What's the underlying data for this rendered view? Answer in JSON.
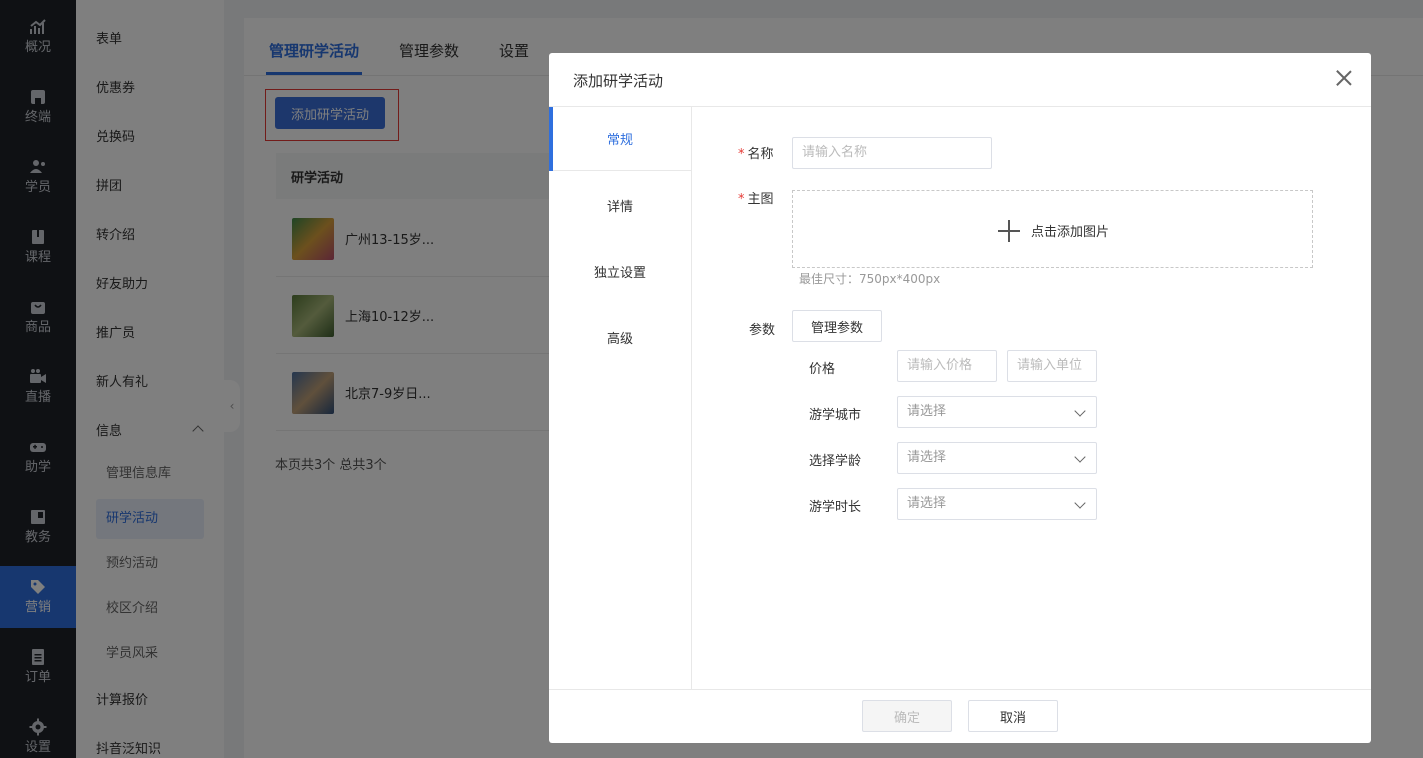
{
  "rail": {
    "items": [
      {
        "label": "概况",
        "icon": "chart-icon"
      },
      {
        "label": "终端",
        "icon": "store-icon"
      },
      {
        "label": "学员",
        "icon": "users-icon"
      },
      {
        "label": "课程",
        "icon": "book-icon"
      },
      {
        "label": "商品",
        "icon": "bag-icon"
      },
      {
        "label": "直播",
        "icon": "video-icon"
      },
      {
        "label": "助学",
        "icon": "gamepad-icon"
      },
      {
        "label": "教务",
        "icon": "board-icon"
      },
      {
        "label": "营销",
        "icon": "tag-icon"
      },
      {
        "label": "订单",
        "icon": "document-icon"
      },
      {
        "label": "设置",
        "icon": "gear-icon"
      }
    ],
    "active": "营销"
  },
  "subnav": {
    "items": [
      "表单",
      "优惠券",
      "兑换码",
      "拼团",
      "转介绍",
      "好友助力",
      "推广员",
      "新人有礼",
      "信息"
    ],
    "children": [
      "管理信息库",
      "研学活动",
      "预约活动",
      "校区介绍",
      "学员风采"
    ],
    "tail": [
      "计算报价",
      "抖音泛知识"
    ],
    "active_child": "研学活动"
  },
  "main": {
    "tabs": [
      "管理研学活动",
      "管理参数",
      "设置"
    ],
    "add_button": "添加研学活动",
    "table_header": "研学活动",
    "rows": [
      {
        "name": "广州13-15岁..."
      },
      {
        "name": "上海10-12岁..."
      },
      {
        "name": "北京7-9岁日..."
      }
    ],
    "page_info": "本页共3个 总共3个"
  },
  "modal": {
    "title": "添加研学活动",
    "tabs": [
      "常规",
      "详情",
      "独立设置",
      "高级"
    ],
    "form": {
      "name_label": "名称",
      "name_placeholder": "请输入名称",
      "image_label": "主图",
      "upload_text": "点击添加图片",
      "image_hint": "最佳尺寸：750px*400px",
      "params_label": "参数",
      "manage_params_button": "管理参数",
      "price_label": "价格",
      "price_placeholder": "请输入价格",
      "unit_placeholder": "请输入单位",
      "city_label": "游学城市",
      "age_label": "选择学龄",
      "duration_label": "游学时长",
      "select_placeholder": "请选择"
    },
    "ok_button": "确定",
    "cancel_button": "取消"
  },
  "colors": {
    "accent": "#2f6fde",
    "required": "#e53935",
    "rail_bg": "#1f2329"
  }
}
